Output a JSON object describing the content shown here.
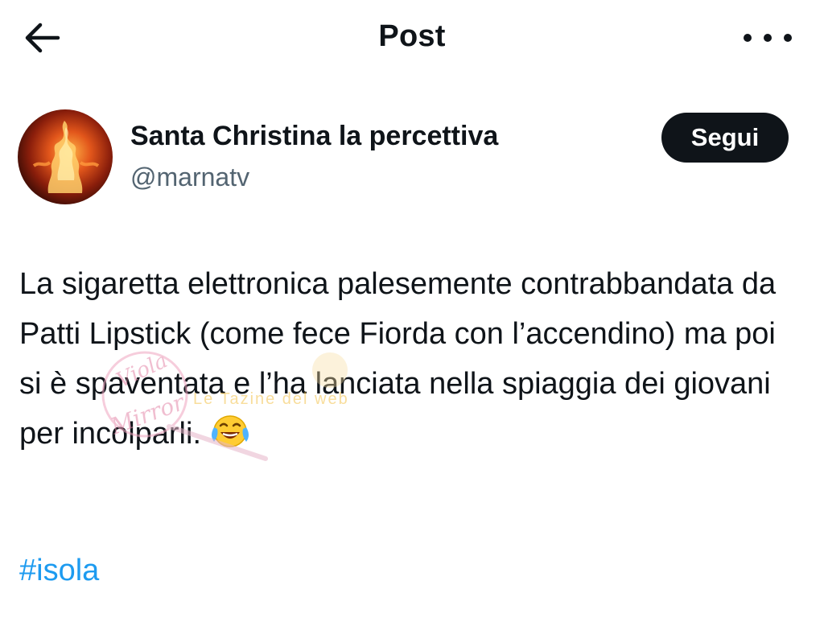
{
  "header": {
    "title": "Post",
    "back_icon": "arrow-left-icon",
    "more_icon": "more-horizontal-icon"
  },
  "author": {
    "name": "Santa Christina la percettiva",
    "handle": "@marnatv",
    "follow_label": "Segui",
    "avatar_icon": "fire-figure-avatar"
  },
  "post": {
    "text": "La sigaretta elettronica palesemente contrabbandata da Patti Lipstick (come fece Fiorda con l’accendino) ma poi si è spaventata e l’ha lanciata nella spiaggia dei giovani per incolparli.",
    "emoji_icon": "face-with-tears-of-joy-icon",
    "hashtag": "#isola"
  },
  "colors": {
    "text": "#0f1419",
    "secondary": "#536471",
    "link": "#1d9bf0",
    "button_bg": "#0f1419",
    "button_text": "#ffffff"
  }
}
